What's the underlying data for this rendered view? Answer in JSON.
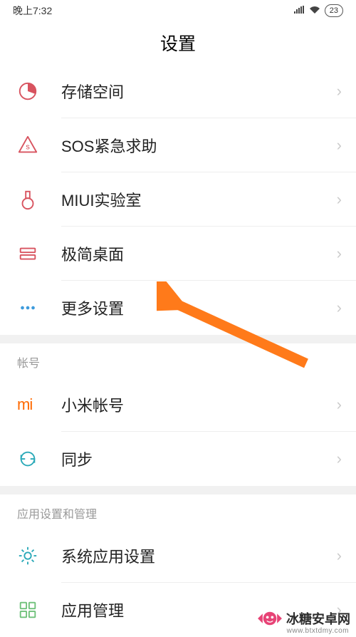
{
  "status": {
    "time": "晚上7:32",
    "battery": "23"
  },
  "title": "设置",
  "rows": {
    "storage": "存储空间",
    "sos": "SOS紧急求助",
    "lab": "MIUI实验室",
    "simple": "极简桌面",
    "more": "更多设置",
    "miaccount": "小米帐号",
    "sync": "同步",
    "sysapp": "系统应用设置",
    "appmgmt": "应用管理"
  },
  "sections": {
    "account": "帐号",
    "appmgmt": "应用设置和管理"
  },
  "watermark": {
    "text": "冰糖安卓网",
    "url": "www.btxtdmy.com"
  },
  "colors": {
    "accent_orange": "#ff6900",
    "accent_red": "#d8535f",
    "accent_blue": "#3e9bdc",
    "accent_teal": "#2aa9b8",
    "accent_green": "#6fc17a",
    "arrow": "#ff7a1a"
  }
}
